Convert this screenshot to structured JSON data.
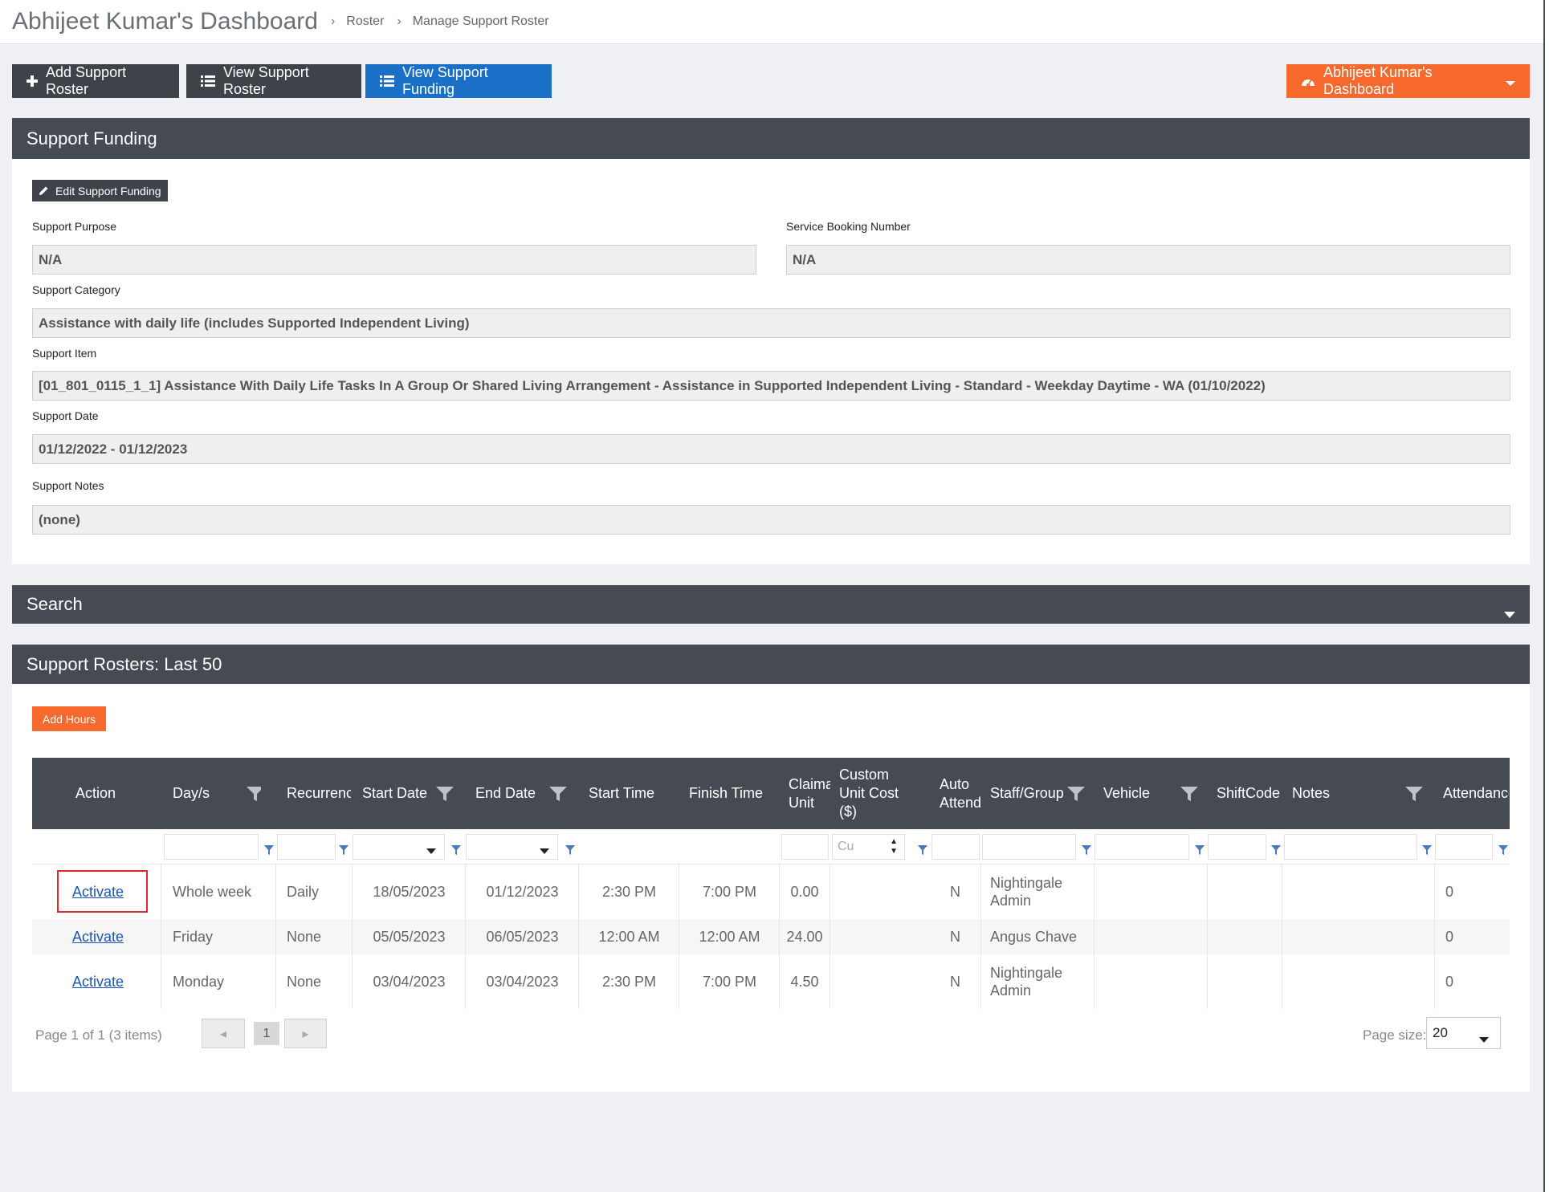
{
  "header": {
    "title": "Abhijeet Kumar's Dashboard",
    "breadcrumb": [
      "Roster",
      "Manage Support Roster"
    ]
  },
  "toolbar": {
    "add_roster": "Add Support Roster",
    "view_roster": "View Support Roster",
    "view_funding": "View Support Funding",
    "dashboard_menu": "Abhijeet Kumar's Dashboard"
  },
  "funding": {
    "title": "Support Funding",
    "edit_button": "Edit Support Funding",
    "purpose_label": "Support Purpose",
    "purpose_value": "N/A",
    "booking_label": "Service Booking Number",
    "booking_value": "N/A",
    "category_label": "Support Category",
    "category_value": "Assistance with daily life (includes Supported Independent Living)",
    "item_label": "Support Item",
    "item_value": "[01_801_0115_1_1] Assistance With Daily Life Tasks In A Group Or Shared Living Arrangement - Assistance in Supported Independent Living - Standard - Weekday Daytime - WA (01/10/2022)",
    "date_label": "Support Date",
    "date_value": "01/12/2022 - 01/12/2023",
    "notes_label": "Support Notes",
    "notes_value": "(none)"
  },
  "search": {
    "title": "Search"
  },
  "rosters": {
    "title": "Support Rosters: Last 50",
    "add_hours": "Add Hours",
    "columns": {
      "action": "Action",
      "days": "Day/s",
      "recurrence": "Recurrence",
      "start_date": "Start Date",
      "end_date": "End Date",
      "start_time": "Start Time",
      "finish_time": "Finish Time",
      "claim_unit": "Claima Unit",
      "custom_cost": "Custom Unit Cost ($)",
      "auto_attend": "Auto Attend",
      "staff": "Staff/Group",
      "vehicle": "Vehicle",
      "shiftcode": "ShiftCode",
      "notes": "Notes",
      "attendance": "Attendance"
    },
    "filter_placeholder_cost": "Cu",
    "rows": [
      {
        "action": "Activate",
        "days": "Whole week",
        "recurrence": "Daily",
        "start_date": "18/05/2023",
        "end_date": "01/12/2023",
        "start_time": "2:30 PM",
        "finish_time": "7:00 PM",
        "claim_unit": "0.00",
        "custom_cost": "",
        "auto_attend": "N",
        "staff": "Nightingale Admin",
        "vehicle": "",
        "shiftcode": "",
        "notes": "",
        "attendance": "0"
      },
      {
        "action": "Activate",
        "days": "Friday",
        "recurrence": "None",
        "start_date": "05/05/2023",
        "end_date": "06/05/2023",
        "start_time": "12:00 AM",
        "finish_time": "12:00 AM",
        "claim_unit": "24.00",
        "custom_cost": "",
        "auto_attend": "N",
        "staff": "Angus Chave",
        "vehicle": "",
        "shiftcode": "",
        "notes": "",
        "attendance": "0"
      },
      {
        "action": "Activate",
        "days": "Monday",
        "recurrence": "None",
        "start_date": "03/04/2023",
        "end_date": "03/04/2023",
        "start_time": "2:30 PM",
        "finish_time": "7:00 PM",
        "claim_unit": "4.50",
        "custom_cost": "",
        "auto_attend": "N",
        "staff": "Nightingale Admin",
        "vehicle": "",
        "shiftcode": "",
        "notes": "",
        "attendance": "0"
      }
    ],
    "pager": {
      "info": "Page 1 of 1 (3 items)",
      "current_page": "1",
      "page_size_label": "Page size:",
      "page_size": "20"
    }
  },
  "colors": {
    "header_bg": "#464a52",
    "accent_blue": "#1a6fc7",
    "accent_orange": "#f7692d",
    "highlight_red": "#e0282e"
  }
}
